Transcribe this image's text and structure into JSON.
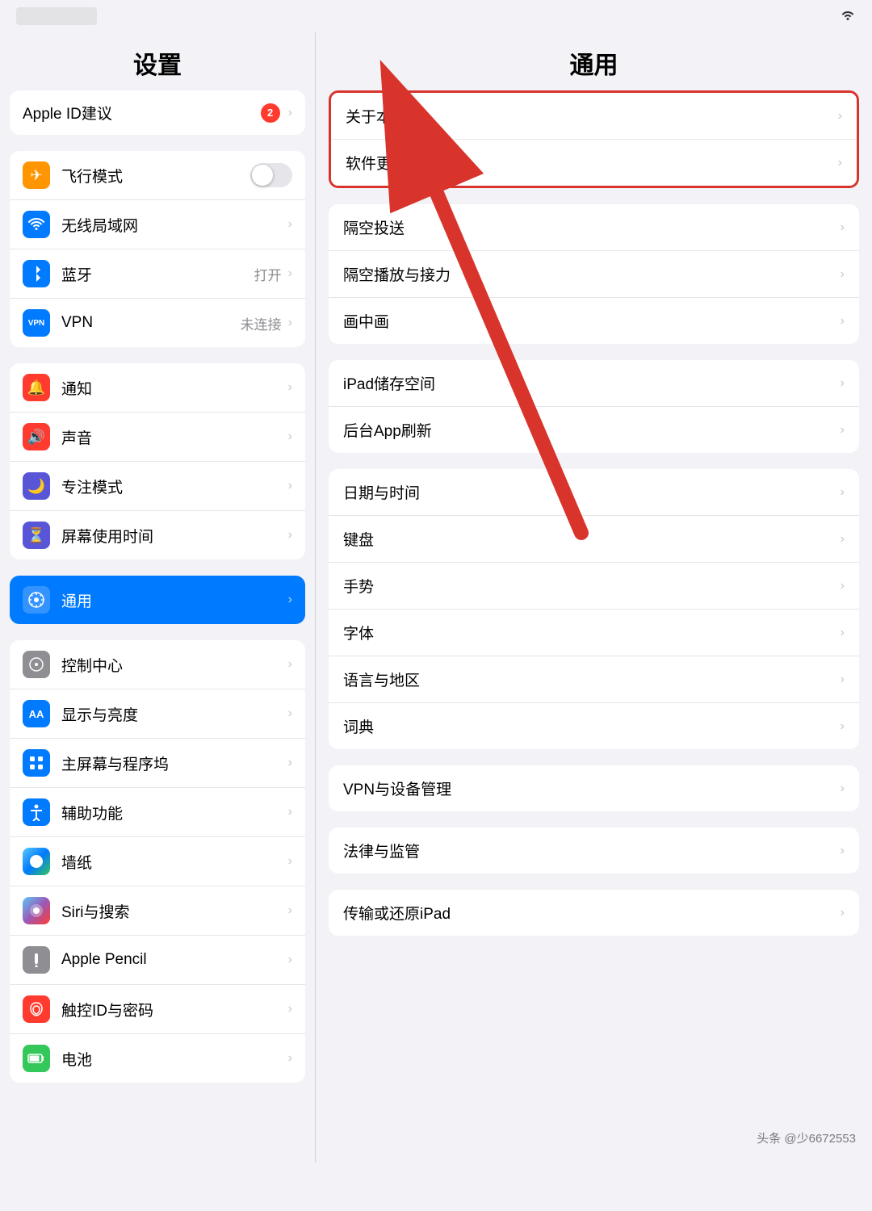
{
  "statusBar": {
    "wifiIcon": "📶"
  },
  "sidebar": {
    "title": "设置",
    "appleId": {
      "label": "Apple ID建议",
      "badge": "2"
    },
    "group1": [
      {
        "id": "airplane",
        "label": "飞行模式",
        "iconBg": "#ff9500",
        "iconSymbol": "✈",
        "hasToggle": true
      },
      {
        "id": "wifi",
        "label": "无线局域网",
        "iconBg": "#007aff",
        "iconSymbol": "wifi",
        "hasChevron": true
      },
      {
        "id": "bluetooth",
        "label": "蓝牙",
        "iconBg": "#007aff",
        "iconSymbol": "bt",
        "value": "打开"
      },
      {
        "id": "vpn",
        "label": "VPN",
        "iconBg": "#007aff",
        "iconSymbol": "VPN",
        "value": "未连接"
      }
    ],
    "group2": [
      {
        "id": "notifications",
        "label": "通知",
        "iconBg": "#ff3b30",
        "iconSymbol": "🔔"
      },
      {
        "id": "sound",
        "label": "声音",
        "iconBg": "#ff3b30",
        "iconSymbol": "🔊"
      },
      {
        "id": "focus",
        "label": "专注模式",
        "iconBg": "#5856d6",
        "iconSymbol": "🌙"
      },
      {
        "id": "screentime",
        "label": "屏幕使用时间",
        "iconBg": "#5856d6",
        "iconSymbol": "⏳"
      }
    ],
    "group3Active": [
      {
        "id": "general",
        "label": "通用",
        "iconBg": "#8e8e93",
        "iconSymbol": "⚙️",
        "active": true
      }
    ],
    "group4": [
      {
        "id": "controlcenter",
        "label": "控制中心",
        "iconBg": "#8e8e93",
        "iconSymbol": "◉"
      },
      {
        "id": "display",
        "label": "显示与亮度",
        "iconBg": "#007aff",
        "iconSymbol": "AA"
      },
      {
        "id": "homescreen",
        "label": "主屏幕与程序坞",
        "iconBg": "#007aff",
        "iconSymbol": "⊞"
      },
      {
        "id": "accessibility",
        "label": "辅助功能",
        "iconBg": "#007aff",
        "iconSymbol": "♿"
      },
      {
        "id": "wallpaper",
        "label": "墙纸",
        "iconBg": "#34c759",
        "iconSymbol": "❀"
      },
      {
        "id": "siri",
        "label": "Siri与搜索",
        "iconBg": "#gradient",
        "iconSymbol": "◎"
      },
      {
        "id": "applepencil",
        "label": "Apple Pencil",
        "iconBg": "#8e8e93",
        "iconSymbol": "✏"
      },
      {
        "id": "touchid",
        "label": "触控ID与密码",
        "iconBg": "#ff3b30",
        "iconSymbol": "👆"
      },
      {
        "id": "battery",
        "label": "电池",
        "iconBg": "#34c759",
        "iconSymbol": "🔋"
      }
    ]
  },
  "rightPanel": {
    "title": "通用",
    "group1": [
      {
        "id": "about",
        "label": "关于本机",
        "highlighted": true
      },
      {
        "id": "softwareupdate",
        "label": "软件更新"
      }
    ],
    "group2": [
      {
        "id": "airdrop",
        "label": "隔空投送"
      },
      {
        "id": "airplay",
        "label": "隔空播放与接力"
      },
      {
        "id": "pip",
        "label": "画中画"
      }
    ],
    "group3": [
      {
        "id": "storage",
        "label": "iPad储存空间"
      },
      {
        "id": "bgrefresh",
        "label": "后台App刷新"
      }
    ],
    "group4": [
      {
        "id": "datetime",
        "label": "日期与时间"
      },
      {
        "id": "keyboard",
        "label": "键盘"
      },
      {
        "id": "gesture",
        "label": "手势"
      },
      {
        "id": "font",
        "label": "字体"
      },
      {
        "id": "language",
        "label": "语言与地区"
      },
      {
        "id": "dictionary",
        "label": "词典"
      }
    ],
    "group5": [
      {
        "id": "vpnmgmt",
        "label": "VPN与设备管理"
      }
    ],
    "group6": [
      {
        "id": "legal",
        "label": "法律与监管"
      }
    ],
    "group7": [
      {
        "id": "transfer",
        "label": "传输或还原iPad"
      }
    ]
  },
  "watermark": "头条 @少6672553"
}
